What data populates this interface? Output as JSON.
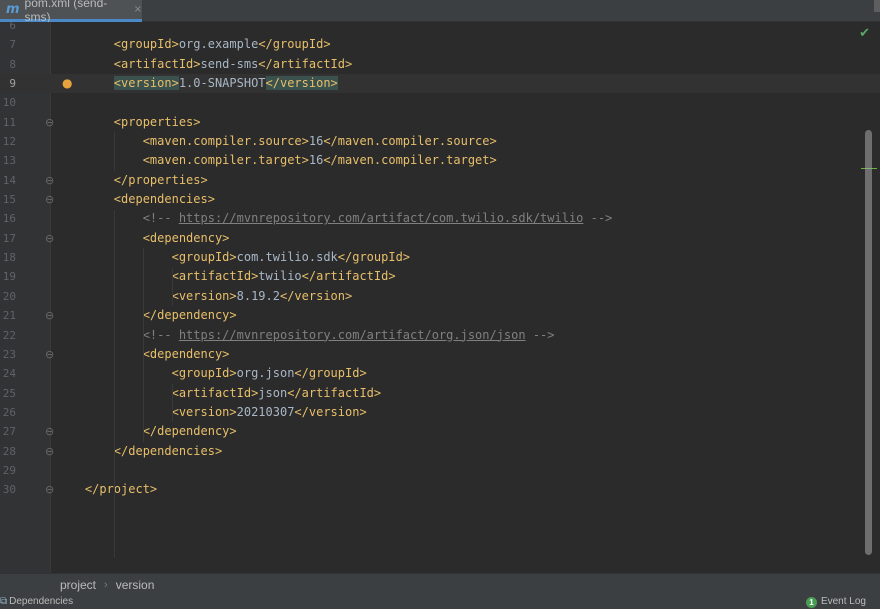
{
  "tab": {
    "icon": "m",
    "title": "pom.xml (send-sms)",
    "close": "×"
  },
  "editor": {
    "lines": [
      {
        "n": "6",
        "indent": "",
        "parts": []
      },
      {
        "n": "7",
        "indent": "    ",
        "parts": [
          {
            "c": "tag",
            "t": "<groupId>"
          },
          {
            "c": "txt",
            "t": "org.example"
          },
          {
            "c": "tag",
            "t": "</groupId>"
          }
        ]
      },
      {
        "n": "8",
        "indent": "    ",
        "parts": [
          {
            "c": "tag",
            "t": "<artifactId>"
          },
          {
            "c": "txt",
            "t": "send-sms"
          },
          {
            "c": "tag",
            "t": "</artifactId>"
          }
        ]
      },
      {
        "n": "9",
        "indent": "    ",
        "current": true,
        "bulb": true,
        "parts": [
          {
            "c": "tag hl",
            "t": "<version>"
          },
          {
            "c": "txt",
            "t": "1.0-SNAPSHOT"
          },
          {
            "c": "tag hl",
            "t": "</version>"
          }
        ]
      },
      {
        "n": "10",
        "indent": "",
        "parts": []
      },
      {
        "n": "11",
        "indent": "    ",
        "fold": "⊖",
        "parts": [
          {
            "c": "tag",
            "t": "<properties>"
          }
        ]
      },
      {
        "n": "12",
        "indent": "        ",
        "parts": [
          {
            "c": "tag",
            "t": "<maven.compiler.source>"
          },
          {
            "c": "txt",
            "t": "16"
          },
          {
            "c": "tag",
            "t": "</maven.compiler.source>"
          }
        ]
      },
      {
        "n": "13",
        "indent": "        ",
        "parts": [
          {
            "c": "tag",
            "t": "<maven.compiler.target>"
          },
          {
            "c": "txt",
            "t": "16"
          },
          {
            "c": "tag",
            "t": "</maven.compiler.target>"
          }
        ]
      },
      {
        "n": "14",
        "indent": "    ",
        "fold": "⊖",
        "parts": [
          {
            "c": "tag",
            "t": "</properties>"
          }
        ]
      },
      {
        "n": "15",
        "indent": "    ",
        "fold": "⊖",
        "parts": [
          {
            "c": "tag",
            "t": "<dependencies>"
          }
        ]
      },
      {
        "n": "16",
        "indent": "        ",
        "parts": [
          {
            "c": "cmt",
            "t": "<!-- "
          },
          {
            "c": "url",
            "t": "https://mvnrepository.com/artifact/com.twilio.sdk/twilio"
          },
          {
            "c": "cmt",
            "t": " -->"
          }
        ]
      },
      {
        "n": "17",
        "indent": "        ",
        "fold": "⊖",
        "parts": [
          {
            "c": "tag",
            "t": "<dependency>"
          }
        ]
      },
      {
        "n": "18",
        "indent": "            ",
        "parts": [
          {
            "c": "tag",
            "t": "<groupId>"
          },
          {
            "c": "txt",
            "t": "com.twilio.sdk"
          },
          {
            "c": "tag",
            "t": "</groupId>"
          }
        ]
      },
      {
        "n": "19",
        "indent": "            ",
        "parts": [
          {
            "c": "tag",
            "t": "<artifactId>"
          },
          {
            "c": "txt",
            "t": "twilio"
          },
          {
            "c": "tag",
            "t": "</artifactId>"
          }
        ]
      },
      {
        "n": "20",
        "indent": "            ",
        "parts": [
          {
            "c": "tag",
            "t": "<version>"
          },
          {
            "c": "txt",
            "t": "8.19.2"
          },
          {
            "c": "tag",
            "t": "</version>"
          }
        ]
      },
      {
        "n": "21",
        "indent": "        ",
        "fold": "⊖",
        "parts": [
          {
            "c": "tag",
            "t": "</dependency>"
          }
        ]
      },
      {
        "n": "22",
        "indent": "        ",
        "parts": [
          {
            "c": "cmt",
            "t": "<!-- "
          },
          {
            "c": "url",
            "t": "https://mvnrepository.com/artifact/org.json/json"
          },
          {
            "c": "cmt",
            "t": " -->"
          }
        ]
      },
      {
        "n": "23",
        "indent": "        ",
        "fold": "⊖",
        "parts": [
          {
            "c": "tag",
            "t": "<dependency>"
          }
        ]
      },
      {
        "n": "24",
        "indent": "            ",
        "parts": [
          {
            "c": "tag",
            "t": "<groupId>"
          },
          {
            "c": "txt",
            "t": "org.json"
          },
          {
            "c": "tag",
            "t": "</groupId>"
          }
        ]
      },
      {
        "n": "25",
        "indent": "            ",
        "parts": [
          {
            "c": "tag",
            "t": "<artifactId>"
          },
          {
            "c": "txt",
            "t": "json"
          },
          {
            "c": "tag",
            "t": "</artifactId>"
          }
        ]
      },
      {
        "n": "26",
        "indent": "            ",
        "parts": [
          {
            "c": "tag",
            "t": "<version>"
          },
          {
            "c": "txt",
            "t": "20210307"
          },
          {
            "c": "tag",
            "t": "</version>"
          }
        ]
      },
      {
        "n": "27",
        "indent": "        ",
        "fold": "⊖",
        "parts": [
          {
            "c": "tag",
            "t": "</dependency>"
          }
        ]
      },
      {
        "n": "28",
        "indent": "    ",
        "fold": "⊖",
        "parts": [
          {
            "c": "tag",
            "t": "</dependencies>"
          }
        ]
      },
      {
        "n": "29",
        "indent": "",
        "parts": []
      },
      {
        "n": "30",
        "indent": "",
        "fold": "⊖",
        "parts": [
          {
            "c": "tag",
            "t": "</project>"
          }
        ]
      }
    ],
    "inspection_icon": "check-icon"
  },
  "breadcrumb": {
    "items": [
      "project",
      "version"
    ],
    "separator": "›"
  },
  "statusbar": {
    "left_label": "Dependencies",
    "event_count": "1",
    "right_label": "Event Log"
  },
  "colors": {
    "background": "#2b2b2b",
    "tag": "#e8bf6a",
    "text": "#a9b7c6",
    "comment": "#808080",
    "ok": "#59a869"
  }
}
